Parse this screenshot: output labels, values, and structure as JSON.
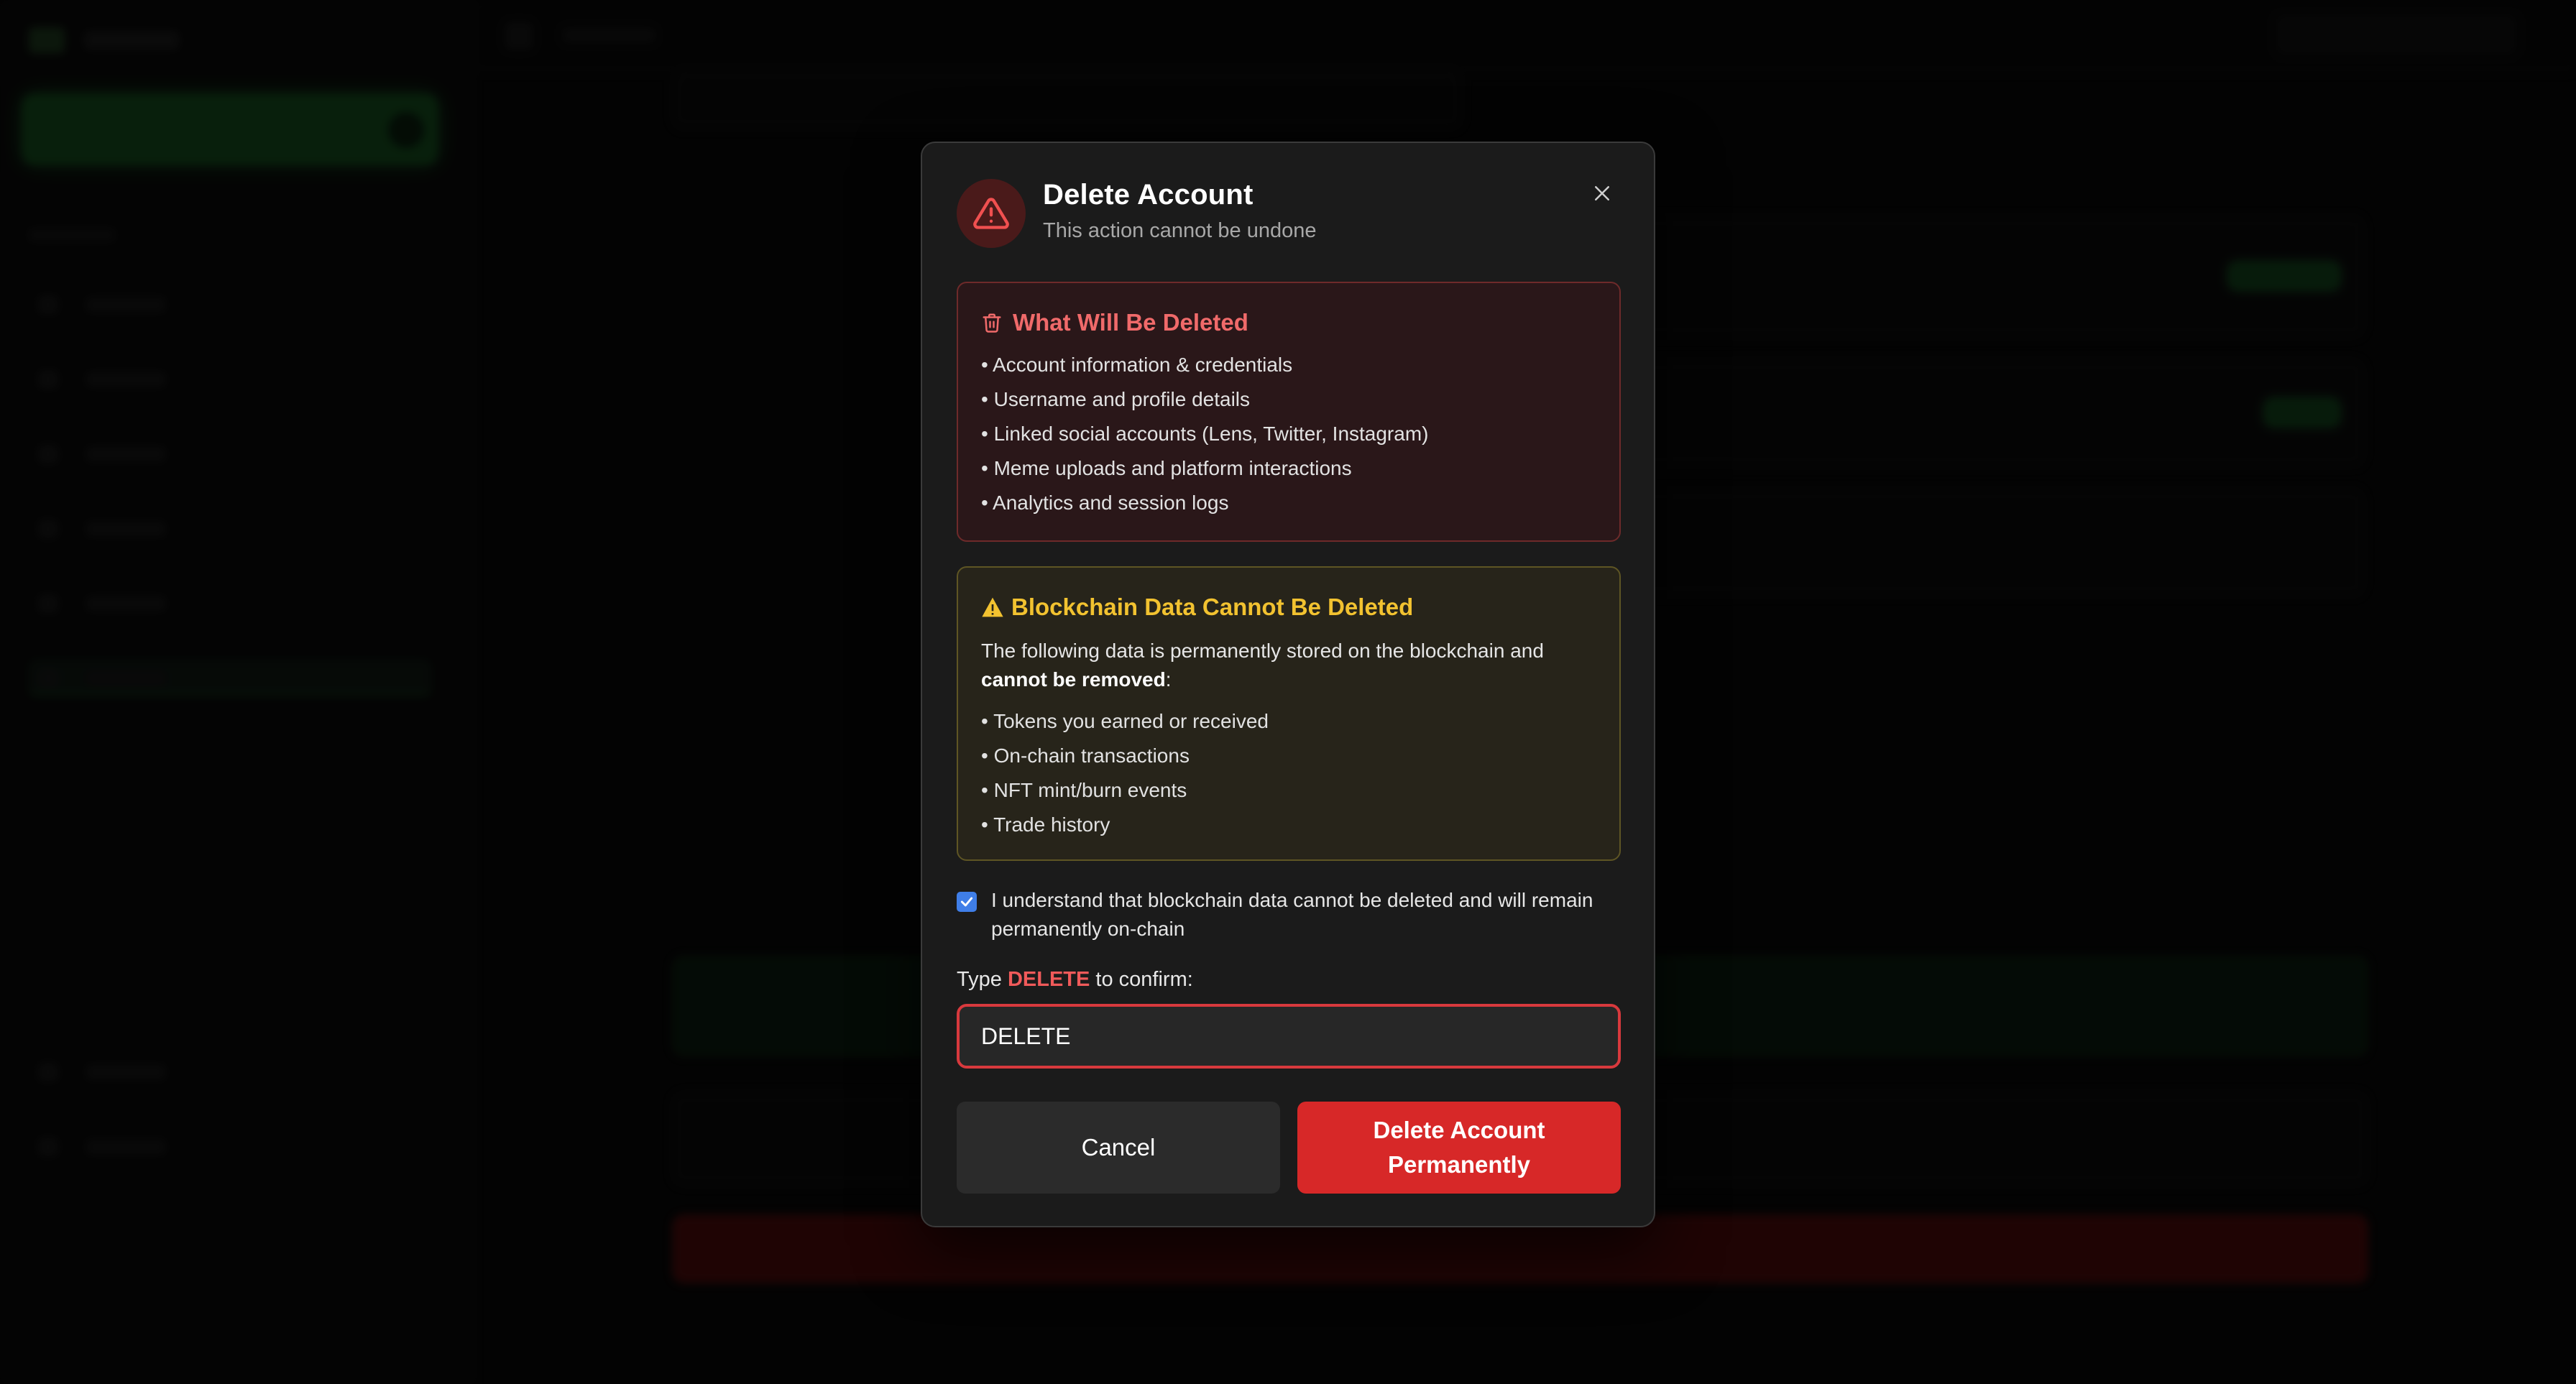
{
  "modal": {
    "title": "Delete Account",
    "subtitle": "This action cannot be undone",
    "header_icon": "warning-triangle-icon",
    "close_icon": "close-icon",
    "deleted_section": {
      "title": "What Will Be Deleted",
      "icon": "trash-icon",
      "items": [
        "Account information & credentials",
        "Username and profile details",
        "Linked social accounts (Lens, Twitter, Instagram)",
        "Meme uploads and platform interactions",
        "Analytics and session logs"
      ]
    },
    "blockchain_section": {
      "title": "Blockchain Data Cannot Be Deleted",
      "icon": "warning-icon",
      "desc_prefix": "The following data is permanently stored on the blockchain and",
      "desc_bold": "cannot be removed",
      "desc_suffix": ":",
      "items": [
        "Tokens you earned or received",
        "On-chain transactions",
        "NFT mint/burn events",
        "Trade history"
      ]
    },
    "acknowledge": {
      "checked": true,
      "text": "I understand that blockchain data cannot be deleted and will remain permanently on-chain"
    },
    "confirm": {
      "label_prefix": "Type",
      "keyword": "DELETE",
      "label_suffix": "to confirm:",
      "value": "DELETE"
    },
    "buttons": {
      "cancel": "Cancel",
      "delete": "Delete Account Permanently"
    }
  },
  "colors": {
    "danger": "#d72828",
    "danger_text": "#f06a6a",
    "warning_text": "#f2c230",
    "checkbox": "#3f7ee8"
  }
}
